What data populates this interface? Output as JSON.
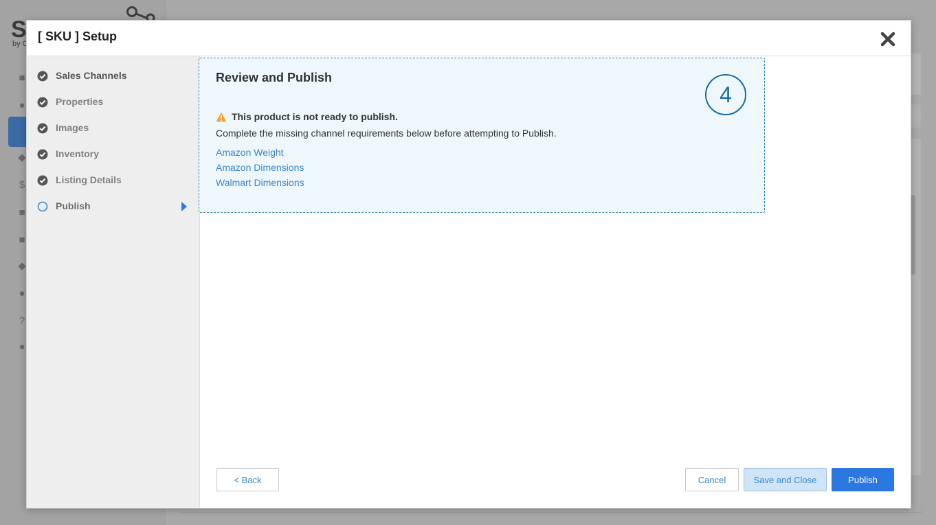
{
  "modal": {
    "title": "[ SKU ] Setup",
    "close_icon": "close-icon"
  },
  "steps": [
    {
      "label": "Sales Channels",
      "status": "complete",
      "icon": "check-circle-icon"
    },
    {
      "label": "Properties",
      "status": "complete",
      "icon": "check-circle-icon"
    },
    {
      "label": "Images",
      "status": "complete",
      "icon": "check-circle-icon"
    },
    {
      "label": "Inventory",
      "status": "complete",
      "icon": "check-circle-icon"
    },
    {
      "label": "Listing Details",
      "status": "complete",
      "icon": "check-circle-icon"
    },
    {
      "label": "Publish",
      "status": "current",
      "icon": "empty-circle-icon"
    }
  ],
  "review": {
    "title": "Review and Publish",
    "step_number": "4",
    "warning_title": "This product is not ready to publish.",
    "warning_description": "Complete the missing channel requirements below before attempting to Publish.",
    "missing_requirements": [
      "Amazon Weight",
      "Amazon Dimensions",
      "Walmart Dimensions"
    ]
  },
  "buttons": {
    "back": "< Back",
    "cancel": "Cancel",
    "save_and_close": "Save and Close",
    "publish": "Publish"
  },
  "background": {
    "logo_text": "Se",
    "logo_sub": "by C"
  },
  "colors": {
    "accent": "#2a78e0",
    "link": "#3a87c8",
    "warning": "#f0a030",
    "step_circle": "#1a6aa8",
    "review_bg": "#eef7fc"
  }
}
